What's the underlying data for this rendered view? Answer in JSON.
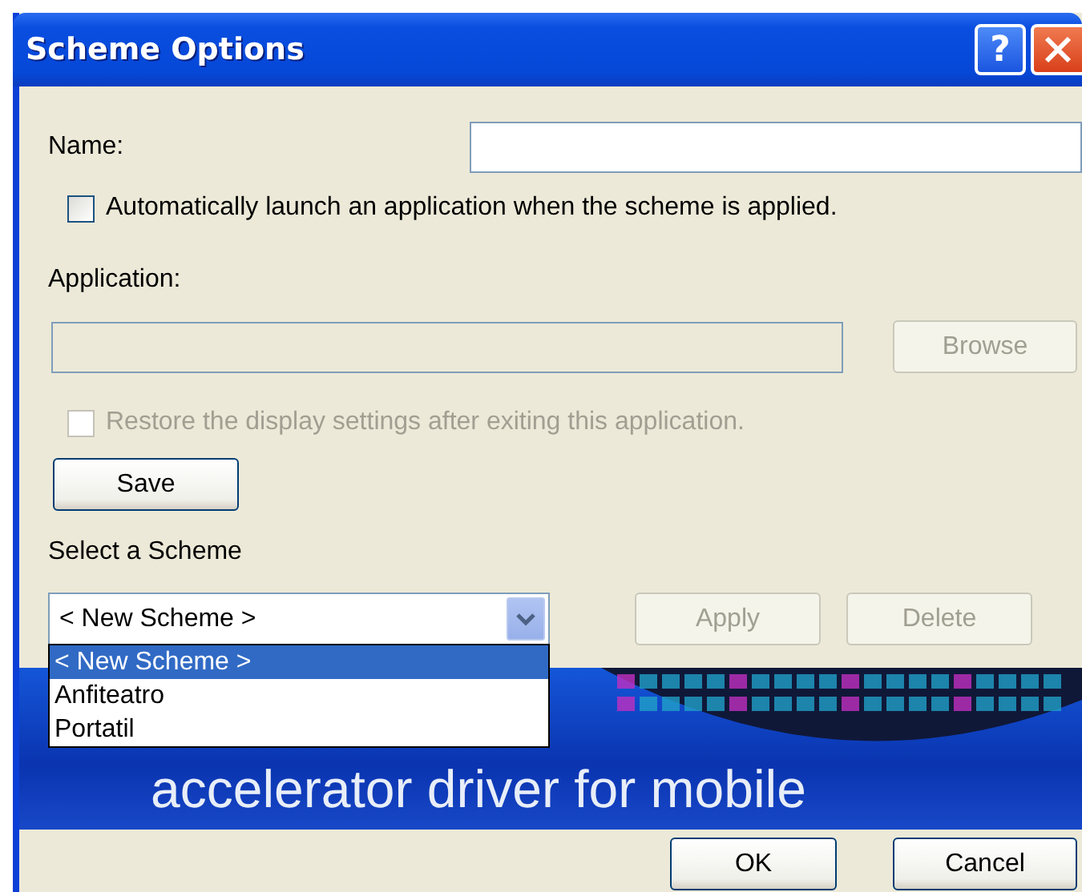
{
  "window": {
    "title": "Scheme Options",
    "help_button": "?"
  },
  "name_field": {
    "label": "Name:"
  },
  "auto_launch": {
    "label": "Automatically launch an application when the scheme is applied.",
    "checked": false,
    "disabled": false
  },
  "application": {
    "label": "Application:",
    "disabled": true
  },
  "browse_button": {
    "label": "Browse",
    "disabled": true
  },
  "restore": {
    "label": "Restore the display settings after exiting this application.",
    "checked": false,
    "disabled": true
  },
  "save_button": {
    "label": "Save",
    "disabled": false
  },
  "scheme_select": {
    "label": "Select a Scheme",
    "value": "< New Scheme >",
    "expanded": true,
    "options": [
      {
        "label": "< New Scheme >",
        "selected": true
      },
      {
        "label": "Anfiteatro",
        "selected": false
      },
      {
        "label": "Portatil",
        "selected": false
      }
    ]
  },
  "apply_button": {
    "label": "Apply",
    "disabled": true
  },
  "delete_button": {
    "label": "Delete",
    "disabled": true
  },
  "banner": {
    "line_2": "accelerator driver for mobile"
  },
  "buttons": [
    {
      "label": "OK",
      "disabled": false
    },
    {
      "label": "Cancel",
      "disabled": false
    }
  ]
}
